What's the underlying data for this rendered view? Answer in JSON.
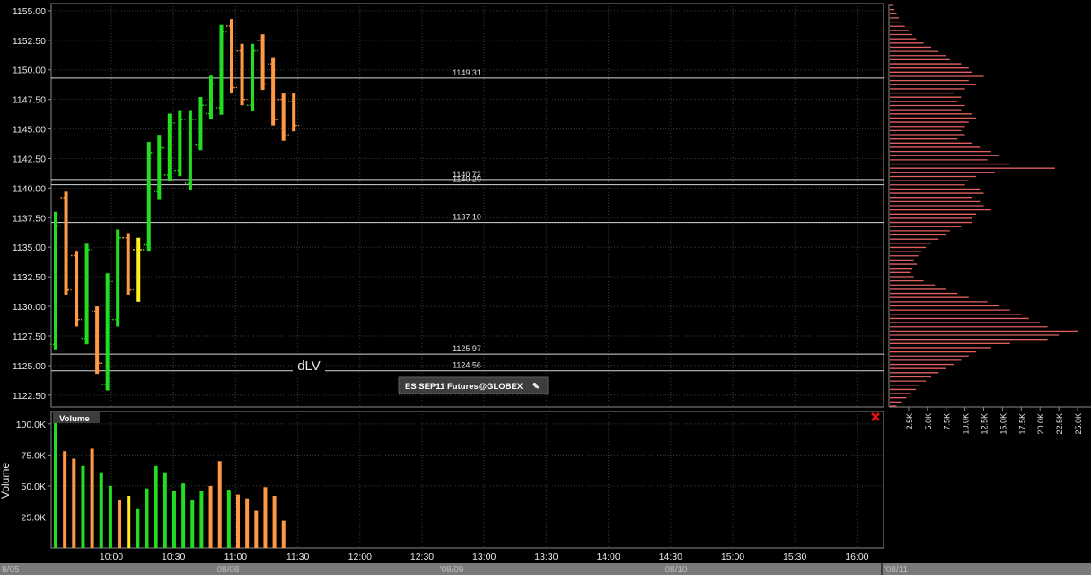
{
  "colors": {
    "background": "#000000",
    "grid": "#3a3a3a",
    "frame": "#8a8a8a",
    "up": "#22dd22",
    "down": "#ff9944",
    "neutral": "#ffee22",
    "level_line": "#d8d8d8",
    "profile": "#e06060",
    "close_x": "#ee1111",
    "date_bar": "#7a7a7a"
  },
  "price_axis": {
    "ticks": [
      "1155.00",
      "1152.50",
      "1150.00",
      "1147.50",
      "1145.00",
      "1142.50",
      "1140.00",
      "1137.50",
      "1135.00",
      "1132.50",
      "1130.00",
      "1127.50",
      "1125.00",
      "1122.50"
    ]
  },
  "time_axis": {
    "ticks": [
      "10:00",
      "10:30",
      "11:00",
      "11:30",
      "12:00",
      "12:30",
      "13:00",
      "13:30",
      "14:00",
      "14:30",
      "15:00",
      "15:30",
      "16:00"
    ]
  },
  "date_labels": {
    "left": "8/05",
    "d1": "'08/08",
    "d2": "'08/09",
    "d3": "'08/10",
    "d4": "'08/11"
  },
  "volume_axis": {
    "label": "Volume",
    "ticks": [
      "100.0K",
      "75.0K",
      "50.0K",
      "25.0K"
    ]
  },
  "profile_axis": {
    "ticks": [
      "2.5K",
      "5.0K",
      "7.5K",
      "10.0K",
      "12.5K",
      "15.0K",
      "17.5K",
      "20.0K",
      "22.5K",
      "25.0K"
    ]
  },
  "instrument_tag": "ES SEP11 Futures@GLOBEX",
  "volume_tag": "Volume",
  "dlv_label": "dLV",
  "levels": [
    {
      "label": "1149.31",
      "value": 1149.31
    },
    {
      "label": "1140.72",
      "value": 1140.72
    },
    {
      "label": "1140.29",
      "value": 1140.29
    },
    {
      "label": "1137.10",
      "value": 1137.1
    },
    {
      "label": "1125.97",
      "value": 1125.97
    },
    {
      "label": "1124.56",
      "value": 1124.56
    }
  ],
  "chart_data": [
    {
      "type": "ohlc",
      "yticks": [
        1155.0,
        1152.5,
        1150.0,
        1147.5,
        1145.0,
        1142.5,
        1140.0,
        1137.5,
        1135.0,
        1132.5,
        1130.0,
        1127.5,
        1125.0,
        1122.5
      ],
      "ylim": [
        1121.5,
        1155.6
      ],
      "bars": [
        {
          "h": 1138.0,
          "l": 1126.3,
          "o": 1126.8,
          "c": 1136.8,
          "dir": "up"
        },
        {
          "h": 1139.7,
          "l": 1131.0,
          "o": 1139.2,
          "c": 1131.4,
          "dir": "down"
        },
        {
          "h": 1134.7,
          "l": 1128.3,
          "o": 1134.3,
          "c": 1128.9,
          "dir": "down"
        },
        {
          "h": 1135.3,
          "l": 1126.8,
          "o": 1127.3,
          "c": 1134.8,
          "dir": "up"
        },
        {
          "h": 1130.0,
          "l": 1124.3,
          "o": 1129.6,
          "c": 1125.2,
          "dir": "down"
        },
        {
          "h": 1132.8,
          "l": 1122.9,
          "o": 1123.4,
          "c": 1132.1,
          "dir": "up"
        },
        {
          "h": 1136.5,
          "l": 1128.3,
          "o": 1128.9,
          "c": 1135.8,
          "dir": "up"
        },
        {
          "h": 1136.2,
          "l": 1131.0,
          "o": 1135.8,
          "c": 1131.4,
          "dir": "down"
        },
        {
          "h": 1135.8,
          "l": 1130.4,
          "o": 1134.8,
          "c": 1134.8,
          "dir": "neutral"
        },
        {
          "h": 1143.9,
          "l": 1134.7,
          "o": 1135.2,
          "c": 1143.0,
          "dir": "up"
        },
        {
          "h": 1144.5,
          "l": 1139.0,
          "o": 1139.7,
          "c": 1143.4,
          "dir": "up"
        },
        {
          "h": 1146.3,
          "l": 1140.6,
          "o": 1141.1,
          "c": 1145.5,
          "dir": "up"
        },
        {
          "h": 1146.6,
          "l": 1141.0,
          "o": 1141.5,
          "c": 1145.8,
          "dir": "up"
        },
        {
          "h": 1146.6,
          "l": 1139.8,
          "o": 1140.4,
          "c": 1145.8,
          "dir": "up"
        },
        {
          "h": 1147.7,
          "l": 1143.2,
          "o": 1143.7,
          "c": 1147.0,
          "dir": "up"
        },
        {
          "h": 1149.5,
          "l": 1145.8,
          "o": 1146.3,
          "c": 1148.8,
          "dir": "up"
        },
        {
          "h": 1153.8,
          "l": 1146.2,
          "o": 1146.8,
          "c": 1153.2,
          "dir": "up"
        },
        {
          "h": 1154.3,
          "l": 1148.0,
          "o": 1153.7,
          "c": 1148.5,
          "dir": "down"
        },
        {
          "h": 1152.2,
          "l": 1147.0,
          "o": 1151.6,
          "c": 1147.5,
          "dir": "down"
        },
        {
          "h": 1152.2,
          "l": 1146.5,
          "o": 1147.0,
          "c": 1151.6,
          "dir": "up"
        },
        {
          "h": 1153.0,
          "l": 1148.3,
          "o": 1152.5,
          "c": 1148.8,
          "dir": "down"
        },
        {
          "h": 1151.0,
          "l": 1145.3,
          "o": 1150.5,
          "c": 1145.8,
          "dir": "down"
        },
        {
          "h": 1148.0,
          "l": 1144.0,
          "o": 1147.5,
          "c": 1144.5,
          "dir": "down"
        },
        {
          "h": 1148.0,
          "l": 1144.8,
          "o": 1147.3,
          "c": 1145.3,
          "dir": "down"
        }
      ]
    },
    {
      "type": "bar",
      "title": "Volume",
      "ylabel": "Volume",
      "ylim": [
        0,
        110000
      ],
      "values": [
        104000,
        78000,
        72000,
        66000,
        80000,
        61000,
        50000,
        39000,
        42000,
        32000,
        48000,
        66000,
        61000,
        46000,
        52000,
        39000,
        46000,
        50000,
        70000,
        47000,
        43000,
        40000,
        30000,
        49000,
        42000,
        22000
      ]
    },
    {
      "type": "bar",
      "orientation": "horizontal",
      "title": "Volume profile",
      "xlim": [
        0,
        25000
      ],
      "levels": 97,
      "values": [
        400,
        600,
        900,
        1200,
        1500,
        2000,
        2500,
        3000,
        3500,
        4500,
        5500,
        6500,
        7500,
        8000,
        9500,
        10500,
        11000,
        12500,
        10500,
        11500,
        10000,
        8500,
        9500,
        9000,
        10000,
        9500,
        11000,
        11500,
        10500,
        10000,
        9500,
        10000,
        9000,
        11000,
        12000,
        13500,
        14500,
        13000,
        16000,
        22000,
        14000,
        11500,
        10500,
        10000,
        12000,
        12500,
        11000,
        12000,
        12500,
        13500,
        11500,
        11000,
        11000,
        9500,
        8000,
        7500,
        6500,
        5500,
        4800,
        4200,
        3800,
        3200,
        3600,
        3000,
        2700,
        3200,
        4500,
        6000,
        7500,
        9000,
        10500,
        13000,
        14500,
        16000,
        17500,
        18500,
        20000,
        21000,
        25000,
        22500,
        21000,
        16000,
        13500,
        11500,
        10500,
        9500,
        8500,
        7500,
        6500,
        5500,
        4800,
        4000,
        3500,
        2800,
        2200,
        1500,
        900
      ]
    }
  ]
}
